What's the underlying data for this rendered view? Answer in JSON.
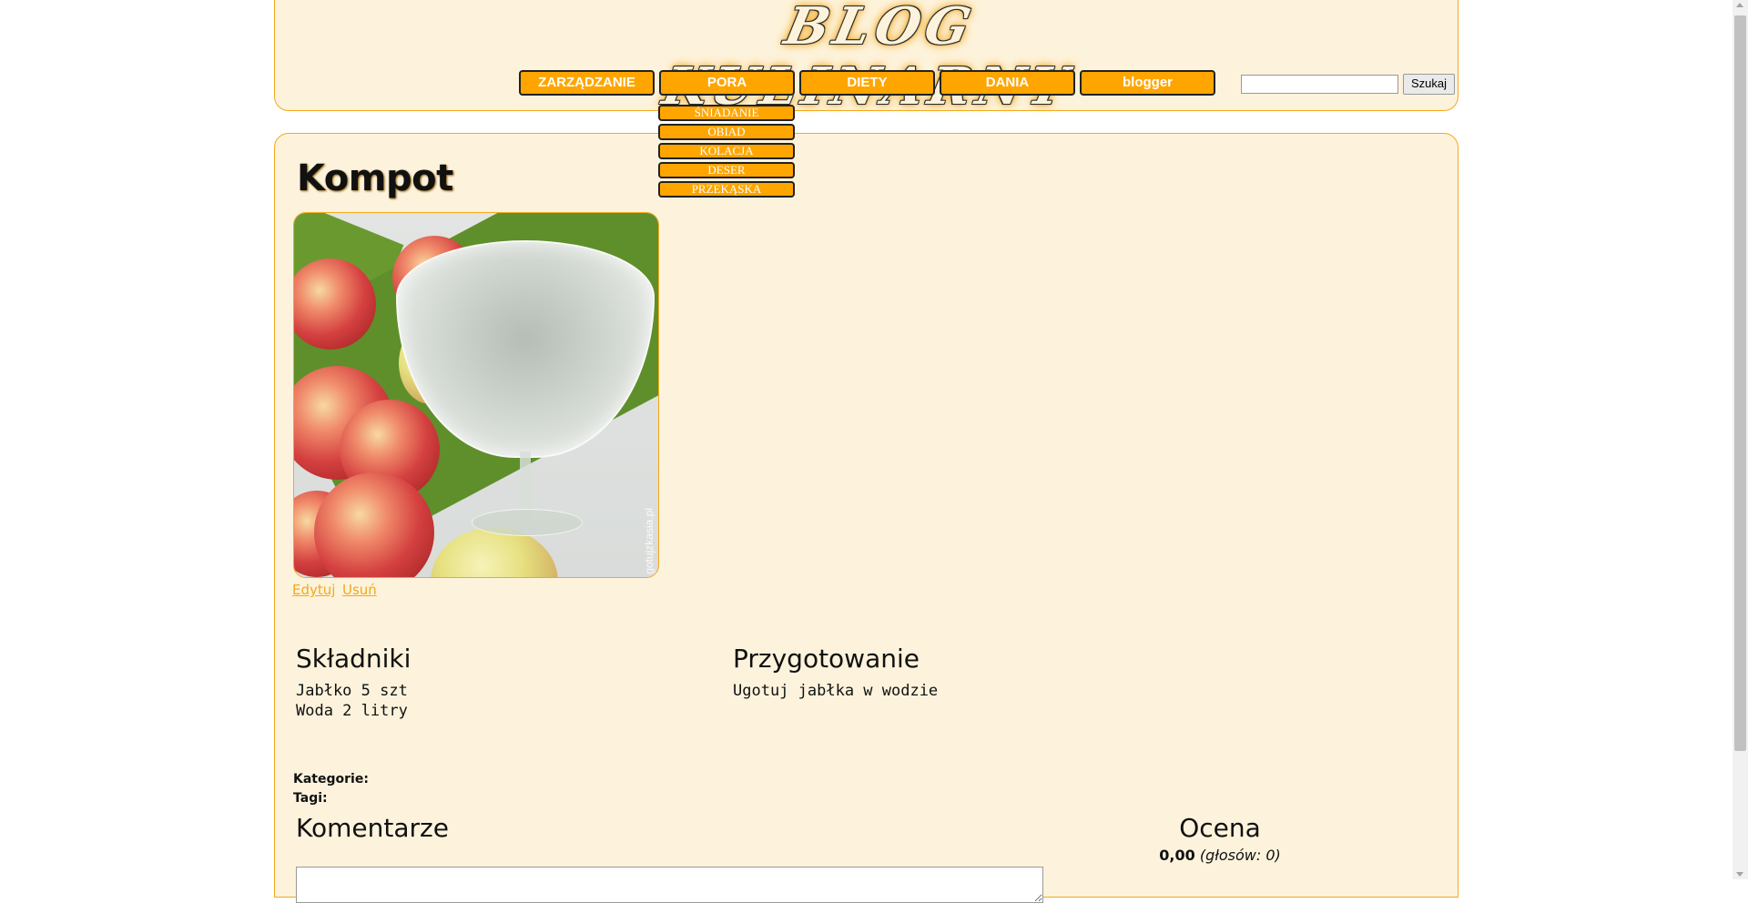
{
  "header": {
    "logo_text": "BLOG KULINARNY",
    "nav": [
      "ZARZĄDZANIE",
      "PORA",
      "DIETY",
      "DANIA",
      "blogger"
    ],
    "submenu": [
      "ŚNIADANIE",
      "OBIAD",
      "KOLACJA",
      "DESER",
      "PRZEKĄSKA"
    ],
    "search": {
      "value": "",
      "button_label": "Szukaj"
    }
  },
  "recipe": {
    "title": "Kompot",
    "photo_watermark": "gotujzkasia.pl",
    "edit_label": "Edytuj",
    "delete_label": "Usuń",
    "ingredients_heading": "Składniki",
    "ingredients": [
      "Jabłko 5 szt",
      "Woda 2 litry"
    ],
    "preparation_heading": "Przygotowanie",
    "preparation": "Ugotuj jabłka w wodzie",
    "categories_label": "Kategorie:",
    "tags_label": "Tagi:"
  },
  "comments": {
    "heading": "Komentarze"
  },
  "rating": {
    "heading": "Ocena",
    "value": "0,00",
    "votes": "(głosów: 0)"
  },
  "colors": {
    "accent": "#ffa500",
    "panel_bg": "#fdf3dc",
    "border": "#f4a81c",
    "link": "#f4a81c"
  }
}
